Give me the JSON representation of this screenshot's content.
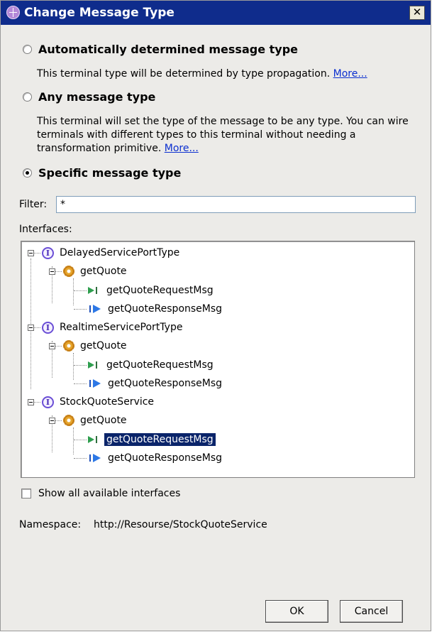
{
  "dialog": {
    "title": "Change Message Type",
    "close_label": "✕"
  },
  "options": {
    "auto": {
      "label": "Automatically determined message type",
      "description": "This terminal type will be determined by type propagation.",
      "link": "More..."
    },
    "any": {
      "label": "Any message type",
      "description": "This terminal will set the type of the message to be any type. You can wire terminals with different types to this terminal without needing a transformation primitive.",
      "link": "More..."
    },
    "specific": {
      "label": "Specific message type",
      "selected": true
    }
  },
  "filter": {
    "label": "Filter:",
    "value": "*"
  },
  "interfaces": {
    "label": "Interfaces:",
    "tree": [
      {
        "name": "DelayedServicePortType",
        "operation": "getQuote",
        "request": "getQuoteRequestMsg",
        "response": "getQuoteResponseMsg"
      },
      {
        "name": "RealtimeServicePortType",
        "operation": "getQuote",
        "request": "getQuoteRequestMsg",
        "response": "getQuoteResponseMsg"
      },
      {
        "name": "StockQuoteService",
        "operation": "getQuote",
        "request": "getQuoteRequestMsg",
        "response": "getQuoteResponseMsg"
      }
    ],
    "selected_item": "StockQuoteService / getQuote / getQuoteRequestMsg"
  },
  "show_all": {
    "label": "Show all available interfaces",
    "checked": false
  },
  "namespace": {
    "label": "Namespace:",
    "value": "http://Resourse/StockQuoteService"
  },
  "buttons": {
    "ok": "OK",
    "cancel": "Cancel"
  },
  "colors": {
    "titlebar": "#0f2c8c",
    "dialog_bg": "#ecebe8",
    "selection": "#0a246a",
    "link": "#0b2fd0"
  }
}
